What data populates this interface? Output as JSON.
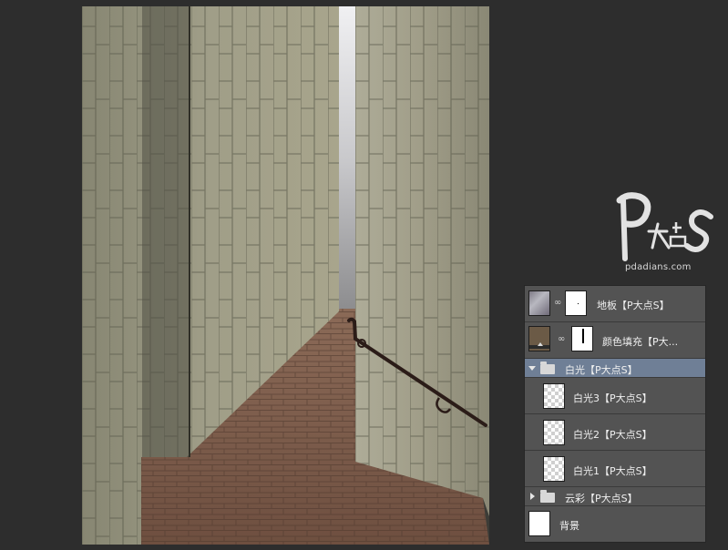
{
  "watermark": {
    "logo_text": "P大点S",
    "url": "pdadians.com"
  },
  "layers_panel": {
    "layers": [
      {
        "name": "地板【P大点S】",
        "type": "layer",
        "thumb": "rock-texture",
        "mask": "white-with-dot",
        "linked": true
      },
      {
        "name": "颜色填充【P大...",
        "type": "fill",
        "thumb": "brown-fill",
        "mask": "white-with-line",
        "linked": true
      },
      {
        "name": "白光【P大点S】",
        "type": "group",
        "expanded": true,
        "selected": true
      },
      {
        "name": "白光3【P大点S】",
        "type": "layer",
        "thumb": "transparent",
        "indent": true
      },
      {
        "name": "白光2【P大点S】",
        "type": "layer",
        "thumb": "transparent",
        "indent": true
      },
      {
        "name": "白光1【P大点S】",
        "type": "layer",
        "thumb": "transparent",
        "indent": true
      },
      {
        "name": "云彩【P大点S】",
        "type": "group",
        "expanded": false
      },
      {
        "name": "背景",
        "type": "layer",
        "thumb": "white"
      }
    ]
  },
  "colors": {
    "app_background": "#2d2d2d",
    "panel_background": "#535353",
    "selected_row": "#6f7f96",
    "wall_stone": "#9b9a86",
    "floor_brick": "#7a5c4c",
    "fill_color": "#6b5a46"
  }
}
